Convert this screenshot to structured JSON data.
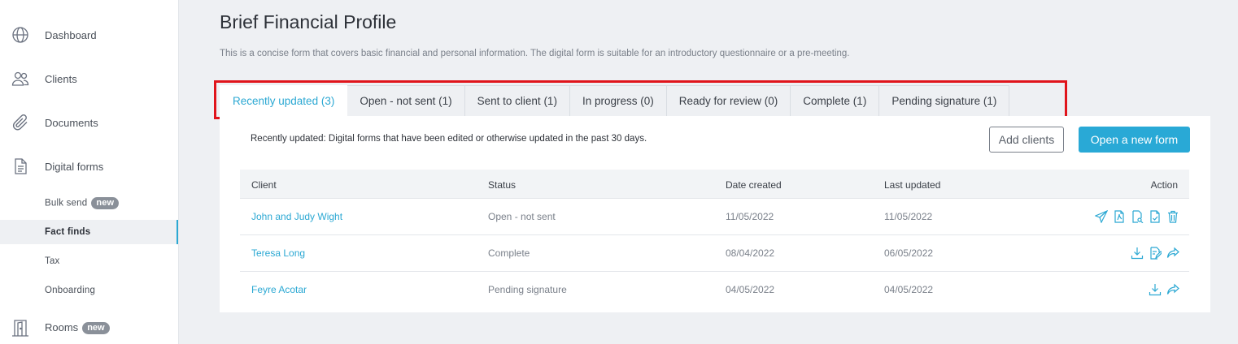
{
  "sidebar": {
    "items": [
      {
        "label": "Dashboard",
        "icon": "globe-icon"
      },
      {
        "label": "Clients",
        "icon": "users-icon"
      },
      {
        "label": "Documents",
        "icon": "paperclip-icon"
      },
      {
        "label": "Digital forms",
        "icon": "document-icon"
      }
    ],
    "subitems": [
      {
        "label": "Bulk send",
        "badge": "new"
      },
      {
        "label": "Fact finds",
        "active": true
      },
      {
        "label": "Tax"
      },
      {
        "label": "Onboarding"
      }
    ],
    "rooms": {
      "label": "Rooms",
      "badge": "new",
      "icon": "door-icon"
    }
  },
  "page": {
    "title": "Brief Financial Profile",
    "description": "This is a concise form that covers basic financial and personal information. The digital form is suitable for an introductory questionnaire or a pre-meeting."
  },
  "tabs": [
    {
      "label": "Recently updated (3)",
      "active": true
    },
    {
      "label": "Open - not sent (1)"
    },
    {
      "label": "Sent to client (1)"
    },
    {
      "label": "In progress (0)"
    },
    {
      "label": "Ready for review (0)"
    },
    {
      "label": "Complete (1)"
    },
    {
      "label": "Pending signature (1)"
    }
  ],
  "panel": {
    "description": "Recently updated: Digital forms that have been edited or otherwise updated in the past 30 days.",
    "add_clients_label": "Add clients",
    "open_form_label": "Open a new form"
  },
  "table": {
    "headers": {
      "client": "Client",
      "status": "Status",
      "created": "Date created",
      "updated": "Last updated",
      "action": "Action"
    },
    "rows": [
      {
        "client": "John and Judy Wight",
        "status": "Open - not sent",
        "created": "11/05/2022",
        "updated": "11/05/2022",
        "actions": [
          "send-icon",
          "pdf-icon",
          "preview-icon",
          "checklist-icon",
          "trash-icon"
        ]
      },
      {
        "client": "Teresa Long",
        "status": "Complete",
        "created": "08/04/2022",
        "updated": "06/05/2022",
        "actions": [
          "download-icon",
          "sign-icon",
          "share-icon"
        ]
      },
      {
        "client": "Feyre Acotar",
        "status": "Pending signature",
        "created": "04/05/2022",
        "updated": "04/05/2022",
        "actions": [
          "download-icon",
          "share-icon"
        ]
      }
    ]
  },
  "colors": {
    "accent": "#29a9d6",
    "highlight": "#e0141b",
    "background": "#eef0f3"
  }
}
